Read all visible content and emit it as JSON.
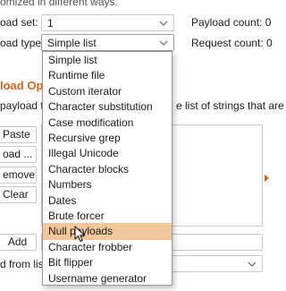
{
  "header_text": "omized in different ways.",
  "payload_set": {
    "label": "oad set:",
    "value": "1"
  },
  "payload_count": "Payload count: 0",
  "payload_type": {
    "label": "oad type:",
    "value": "Simple list"
  },
  "request_count": "Request count: 0",
  "section_title": "load Op",
  "section_desc_left": "payload ty",
  "section_desc_right": "e list of strings that are",
  "buttons": {
    "paste": "Paste",
    "load": "oad ...",
    "remove": "emove",
    "clear": "Clear",
    "add": "Add"
  },
  "add_from_list": "d from list",
  "dropdown_options": [
    "Simple list",
    "Runtime file",
    "Custom iterator",
    "Character substitution",
    "Case modification",
    "Recursive grep",
    "Illegal Unicode",
    "Character blocks",
    "Numbers",
    "Dates",
    "Brute forcer",
    "Null payloads",
    "Character frobber",
    "Bit flipper",
    "Username generator"
  ],
  "highlighted_option": "Null payloads",
  "colors": {
    "accent": "#d9641f",
    "highlight": "#f2c79c"
  }
}
